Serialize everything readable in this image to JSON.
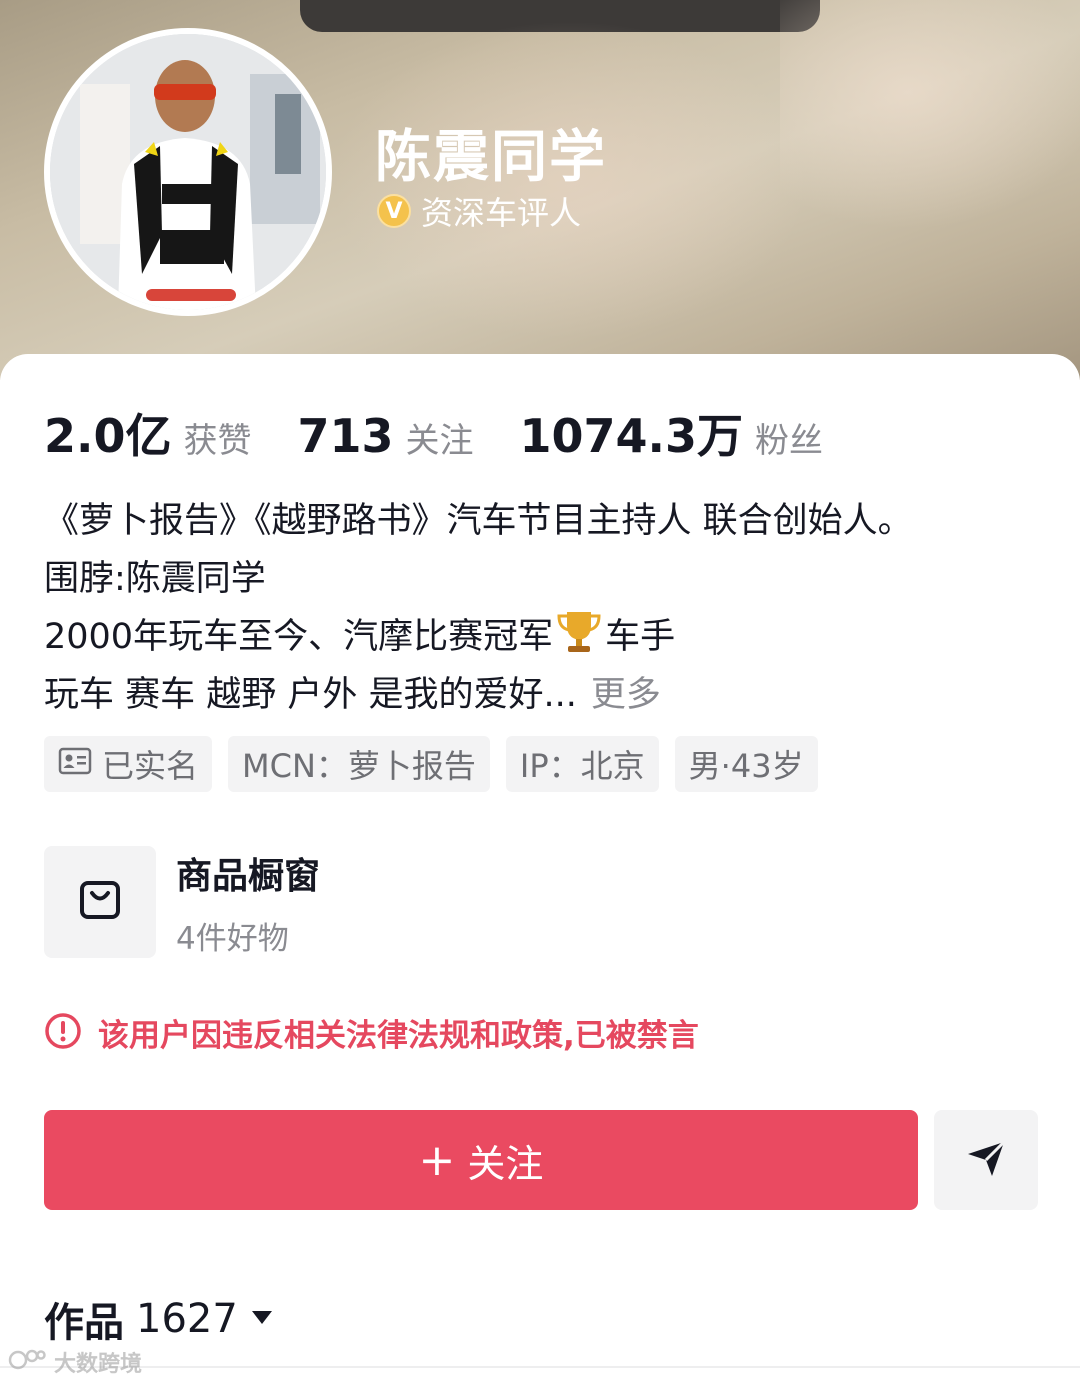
{
  "profile": {
    "name": "陈震同学",
    "verify_label": "资深车评人",
    "verify_badge": "V"
  },
  "stats": [
    {
      "value": "2.0亿",
      "label": "获赞"
    },
    {
      "value": "713",
      "label": "关注"
    },
    {
      "value": "1074.3万",
      "label": "粉丝"
    }
  ],
  "bio": {
    "line1": "《萝卜报告》《越野路书》汽车节目主持人 联合创始人。",
    "line2": "围脖:陈震同学",
    "line3a": "2000年玩车至今、汽摩比赛冠军",
    "line3b": "车手",
    "line4": "玩车 赛车 越野 户外 是我的爱好...",
    "more": "更多"
  },
  "tags": [
    {
      "label": "已实名"
    },
    {
      "label": "MCN：萝卜报告"
    },
    {
      "label": "IP：北京"
    },
    {
      "label": "男·43岁"
    }
  ],
  "shop": {
    "title": "商品橱窗",
    "subtitle": "4件好物"
  },
  "warning": "该用户因违反相关法律法规和政策,已被禁言",
  "actions": {
    "follow_plus": "+",
    "follow_label": "关注"
  },
  "works": {
    "label": "作品",
    "count": "1627"
  },
  "watermark": "大数跨境",
  "colors": {
    "accent": "#ea4a61",
    "warning": "#e5485f",
    "verify_gold": "#f4c24c"
  },
  "icons": [
    "id-card-icon",
    "shopping-bag-icon",
    "warning-circle-icon",
    "share-send-icon",
    "dropdown-caret-icon",
    "trophy-icon"
  ]
}
